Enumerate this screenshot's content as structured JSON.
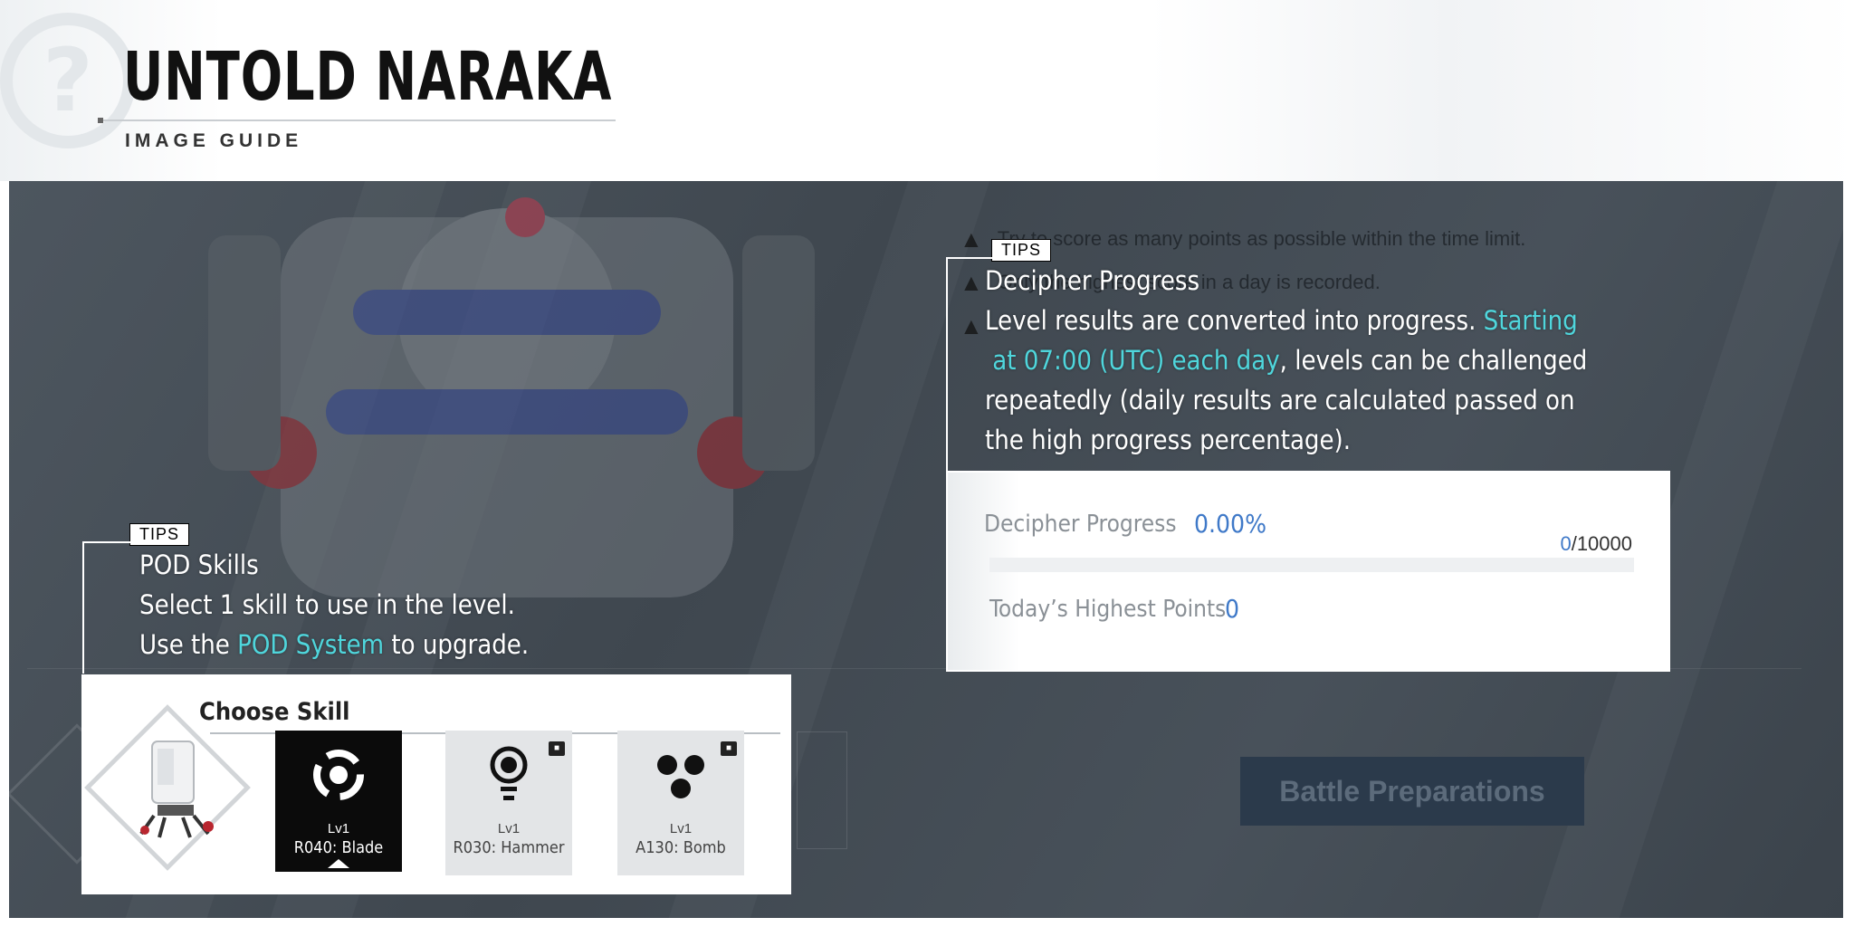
{
  "header": {
    "title": "UNTOLD NARAKA",
    "subtitle": "IMAGE GUIDE",
    "watermark_icon": "help-circle-icon"
  },
  "game": {
    "notices": [
      "Try to score as many points as possible within the time limit.",
      "Only the highest score in a day is recorded.",
      ""
    ],
    "notice_icon": "warning-icon",
    "battle_button_label": "Battle Preparations"
  },
  "tips_decipher": {
    "tab_label": "TIPS",
    "heading": "Decipher Progress",
    "line1_plain": "Level results are converted into progress.",
    "line1_highlight": " Starting",
    "line2_highlight": "at 07:00 (UTC) each day",
    "line2_plain": ", levels can be challenged",
    "line3": "repeatedly (daily results are calculated passed on",
    "line4": "the high progress percentage)."
  },
  "progress_card": {
    "progress_label": "Decipher Progress",
    "progress_value": "0.00%",
    "progress_fraction": 0,
    "count_current": "0",
    "count_total": "/10000",
    "highest_label": "Today’s Highest Points",
    "highest_value": "0"
  },
  "tips_pod": {
    "tab_label": "TIPS",
    "heading": "POD Skills",
    "line1": "Select 1 skill to use in the level.",
    "line2_before": "Use the ",
    "line2_highlight": "POD System",
    "line2_after": " to upgrade."
  },
  "skill_panel": {
    "title": "Choose Skill",
    "skills": [
      {
        "level": "Lv1",
        "name": "R040: Blade",
        "state": "selected",
        "icon": "blade-skill-icon"
      },
      {
        "level": "Lv1",
        "name": "R030: Hammer",
        "state": "locked",
        "icon": "hammer-skill-icon"
      },
      {
        "level": "Lv1",
        "name": "A130: Bomb",
        "state": "locked",
        "icon": "bomb-skill-icon"
      }
    ]
  },
  "colors": {
    "highlight": "#4fd6dc",
    "progress_blue": "#3f79c8",
    "screen_bg": "#434b54"
  }
}
